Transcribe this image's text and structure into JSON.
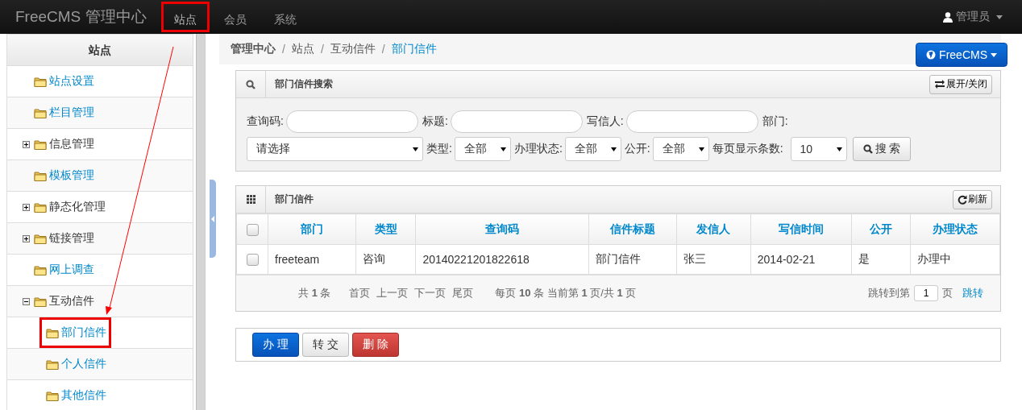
{
  "navbar": {
    "brand": "FreeCMS 管理中心",
    "items": [
      {
        "label": "站点",
        "selected": true,
        "annotated": true
      },
      {
        "label": "会员",
        "selected": false,
        "annotated": false
      },
      {
        "label": "系统",
        "selected": false,
        "annotated": false
      }
    ],
    "user": "管理员"
  },
  "sidebar": {
    "title": "站点",
    "items": [
      {
        "label": "站点设置",
        "kind": "leaf",
        "annotated": false
      },
      {
        "label": "栏目管理",
        "kind": "leaf",
        "annotated": false
      },
      {
        "label": "信息管理",
        "kind": "folder",
        "expanded": false,
        "annotated": false
      },
      {
        "label": "模板管理",
        "kind": "leaf",
        "annotated": false
      },
      {
        "label": "静态化管理",
        "kind": "folder",
        "expanded": false,
        "annotated": false
      },
      {
        "label": "链接管理",
        "kind": "folder",
        "expanded": false,
        "annotated": false
      },
      {
        "label": "网上调查",
        "kind": "leaf",
        "annotated": false
      },
      {
        "label": "互动信件",
        "kind": "folder",
        "expanded": true,
        "annotated": false,
        "children": [
          {
            "label": "部门信件",
            "kind": "leaf",
            "annotated": true
          },
          {
            "label": "个人信件",
            "kind": "leaf",
            "annotated": false
          },
          {
            "label": "其他信件",
            "kind": "leaf",
            "annotated": false
          }
        ]
      }
    ]
  },
  "breadcrumb": [
    {
      "label": "管理中心"
    },
    {
      "separator": "/",
      "label": "站点"
    },
    {
      "separator": "/",
      "label": "互动信件"
    },
    {
      "separator": "/",
      "label": "部门信件"
    }
  ],
  "site_button": "FreeCMS",
  "search_panel": {
    "title": "部门信件搜索",
    "toggle": "展开/关闭",
    "fields": [
      {
        "label": "查询码:"
      },
      {
        "label": "标题:"
      },
      {
        "label": "写信人:"
      }
    ],
    "dept_label": "部门:",
    "dept_select": "请选择",
    "selects": [
      {
        "label": "类型:",
        "value": "全部"
      },
      {
        "label": "办理状态:",
        "value": "全部"
      },
      {
        "label": "公开:",
        "value": "全部"
      }
    ],
    "page_size_label": "每页显示条数:",
    "page_size": "10",
    "search_button": "搜 索"
  },
  "table_panel": {
    "title": "部门信件",
    "refresh": "刷新",
    "select_all_checked": false,
    "columns": [
      "部门",
      "类型",
      "查询码",
      "信件标题",
      "发信人",
      "写信时间",
      "公开",
      "办理状态"
    ],
    "rows": [
      {
        "checked": false,
        "cells": [
          "freeteam",
          "咨询",
          "20140221201822618",
          "部门信件",
          "张三",
          "2014-02-21",
          "是",
          "办理中"
        ]
      }
    ],
    "pager": {
      "total": "共 **1** 条",
      "links": [
        "首页",
        "上一页",
        "下一页",
        "尾页"
      ],
      "info": "每页 **10** 条 当前第 **1** 页/共 **1** 页",
      "jump_label": "跳转到第",
      "jump_value": "1",
      "jump_unit": "页",
      "jump_link": "跳转"
    }
  },
  "actions": [
    {
      "label": "办 理",
      "kind": "primary"
    },
    {
      "label": "转 交",
      "kind": "default"
    },
    {
      "label": "删 除",
      "kind": "danger"
    }
  ]
}
